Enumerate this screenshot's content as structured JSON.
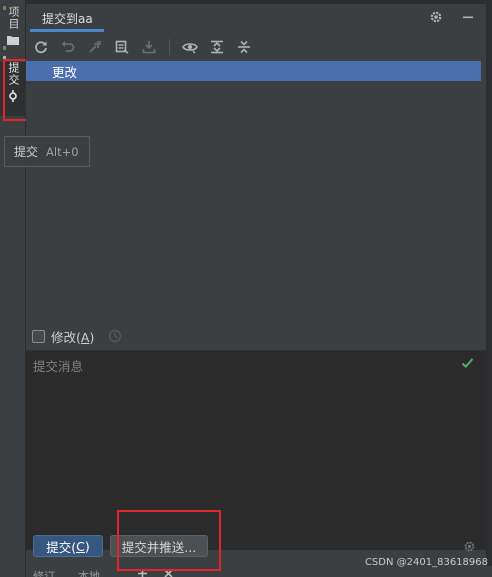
{
  "left_strip": {
    "project_label": "项目",
    "commit_label": "提交"
  },
  "tooltip": {
    "label": "提交",
    "shortcut": "Alt+0"
  },
  "panel": {
    "title": "提交到aa",
    "title_icons": [
      "gear-icon",
      "minimize-icon"
    ],
    "toolbar_icons": [
      "refresh-icon",
      "rollback-icon",
      "move-icon",
      "diff-icon",
      "download-icon",
      "eye-icon",
      "expand-all-icon",
      "collapse-all-icon"
    ]
  },
  "tree": {
    "changes_label": "更改"
  },
  "amend": {
    "label_prefix": "修改(",
    "label_key": "A",
    "label_suffix": ")"
  },
  "message": {
    "placeholder": "提交消息"
  },
  "buttons": {
    "commit_prefix": "提交(",
    "commit_key": "C",
    "commit_suffix": ")",
    "commit_push": "提交并推送..."
  },
  "footer": {
    "left": "修订",
    "branch": "本地"
  },
  "watermark": "CSDN @2401_83618968",
  "colors": {
    "selection": "#4b6eaf",
    "primary_button": "#365880",
    "accent": "#4a88c7",
    "highlight_box": "#e0262b",
    "check_ok": "#59a869"
  }
}
